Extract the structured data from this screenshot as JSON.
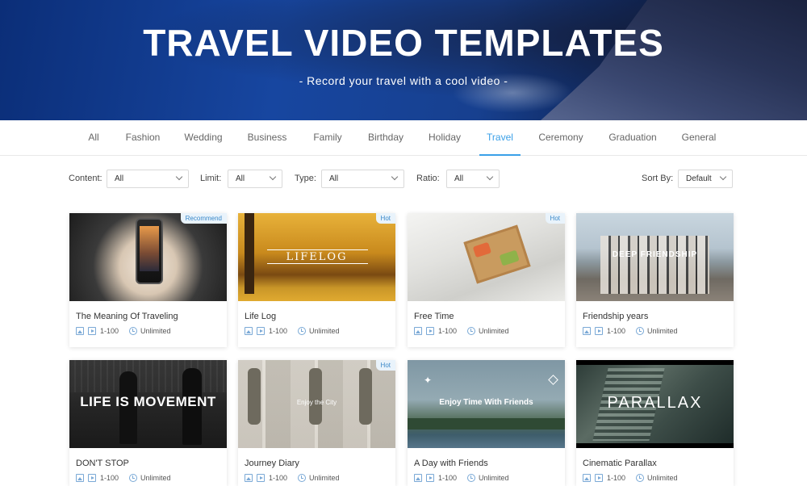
{
  "hero": {
    "title": "TRAVEL VIDEO TEMPLATES",
    "subtitle": "- Record your travel with a cool video -"
  },
  "nav": {
    "items": [
      "All",
      "Fashion",
      "Wedding",
      "Business",
      "Family",
      "Birthday",
      "Holiday",
      "Travel",
      "Ceremony",
      "Graduation",
      "General"
    ],
    "active": "Travel"
  },
  "filters": {
    "content": {
      "label": "Content:",
      "value": "All"
    },
    "limit": {
      "label": "Limit:",
      "value": "All"
    },
    "type": {
      "label": "Type:",
      "value": "All"
    },
    "ratio": {
      "label": "Ratio:",
      "value": "All"
    },
    "sort": {
      "label": "Sort By:",
      "value": "Default"
    }
  },
  "cards": [
    {
      "title": "The Meaning Of Traveling",
      "badge": "Recommend",
      "range": "1-100",
      "duration": "Unlimited",
      "overlay": ""
    },
    {
      "title": "Life Log",
      "badge": "Hot",
      "range": "1-100",
      "duration": "Unlimited",
      "overlay": "LIFELOG"
    },
    {
      "title": "Free Time",
      "badge": "Hot",
      "range": "1-100",
      "duration": "Unlimited",
      "overlay": ""
    },
    {
      "title": "Friendship years",
      "badge": "",
      "range": "1-100",
      "duration": "Unlimited",
      "overlay": "DEEP FRIENDSHIP"
    },
    {
      "title": "DON'T STOP",
      "badge": "",
      "range": "1-100",
      "duration": "Unlimited",
      "overlay": "LIFE IS MOVEMENT"
    },
    {
      "title": "Journey Diary",
      "badge": "Hot",
      "range": "1-100",
      "duration": "Unlimited",
      "overlay": "Enjoy the City"
    },
    {
      "title": "A Day with Friends",
      "badge": "",
      "range": "1-100",
      "duration": "Unlimited",
      "overlay": "Enjoy Time With Friends"
    },
    {
      "title": "Cinematic Parallax",
      "badge": "",
      "range": "1-100",
      "duration": "Unlimited",
      "overlay": "PARALLAX"
    }
  ]
}
